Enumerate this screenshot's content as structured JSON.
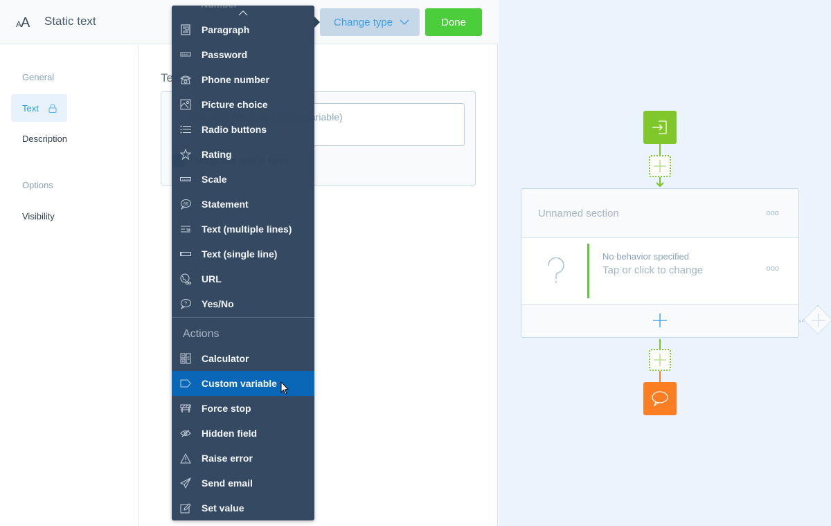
{
  "header": {
    "icon": "font-size-icon",
    "title": "Static text",
    "change_type_label": "Change type",
    "done_label": "Done"
  },
  "sidebar": {
    "groups": [
      {
        "label": "General",
        "items": [
          {
            "label": "Text",
            "active": true,
            "locked": true
          },
          {
            "label": "Description",
            "active": false,
            "locked": false
          }
        ]
      },
      {
        "label": "Options",
        "items": [
          {
            "label": "Visibility",
            "active": false,
            "locked": false
          }
        ]
      }
    ]
  },
  "form": {
    "field_label": "Text",
    "text_placeholder": "Type here (hit @ to insert a variable)",
    "show_in_form_label": "Show this text in form",
    "show_in_form_checked": true
  },
  "menu": {
    "partial_top_item": "Number",
    "question_items": [
      {
        "label": "Paragraph",
        "icon": "paragraph-icon"
      },
      {
        "label": "Password",
        "icon": "password-icon"
      },
      {
        "label": "Phone number",
        "icon": "phone-icon"
      },
      {
        "label": "Picture choice",
        "icon": "picture-icon"
      },
      {
        "label": "Radio buttons",
        "icon": "list-icon"
      },
      {
        "label": "Rating",
        "icon": "star-icon"
      },
      {
        "label": "Scale",
        "icon": "ruler-icon"
      },
      {
        "label": "Statement",
        "icon": "quote-bubble-icon"
      },
      {
        "label": "Text (multiple lines)",
        "icon": "multiline-text-icon"
      },
      {
        "label": "Text (single line)",
        "icon": "single-line-text-icon"
      },
      {
        "label": "URL",
        "icon": "globe-icon"
      },
      {
        "label": "Yes/No",
        "icon": "question-bubble-icon"
      }
    ],
    "actions_heading": "Actions",
    "action_items": [
      {
        "label": "Calculator",
        "icon": "calculator-icon"
      },
      {
        "label": "Custom variable",
        "icon": "tag-icon",
        "highlighted": true
      },
      {
        "label": "Force stop",
        "icon": "barrier-icon"
      },
      {
        "label": "Hidden field",
        "icon": "eye-off-icon"
      },
      {
        "label": "Raise error",
        "icon": "warning-icon"
      },
      {
        "label": "Send email",
        "icon": "paper-plane-icon"
      },
      {
        "label": "Set value",
        "icon": "edit-icon"
      }
    ]
  },
  "canvas": {
    "section_title": "Unnamed section",
    "block_title": "No behavior specified",
    "block_subtitle": "Tap or click to change",
    "more_glyph": "ooo"
  },
  "colors": {
    "accent": "#2a9ae6",
    "done": "#4ccd3c",
    "entry_node": "#80c72b",
    "exit_node": "#fb7f22",
    "menu_bg": "#2f435e",
    "menu_highlight": "#0a67b7"
  }
}
